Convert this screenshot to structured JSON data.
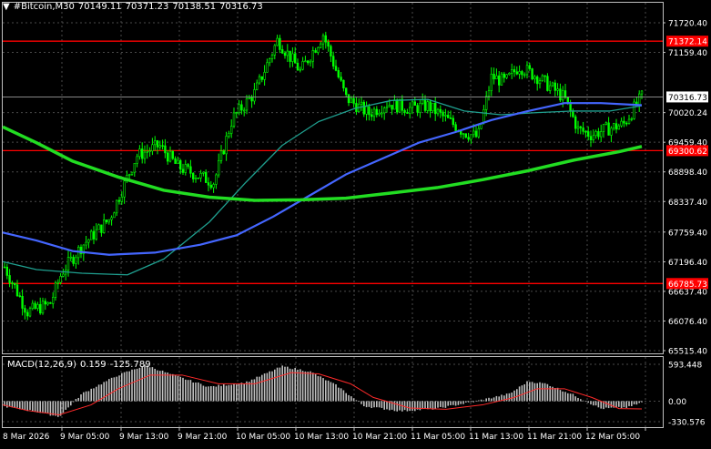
{
  "header": {
    "symbol": "#Bitcoin,M30",
    "open": "70149.11",
    "high": "70371.23",
    "low": "70138.51",
    "close": "70316.73"
  },
  "colors": {
    "background": "#000000",
    "grid": "#4a4a4a",
    "candle": "#00ff00",
    "ma_slow": "#22dd22",
    "ma_mid": "#4466ff",
    "ma_fast": "#1f9f8f",
    "level_line": "#ff0000",
    "macd_hist": "#c0c0c0",
    "macd_signal": "#ff2a2a",
    "axis_text": "#ffffff"
  },
  "price_axis": {
    "ticks": [
      "71720.40",
      "71159.40",
      "70020.24",
      "69459.40",
      "68898.40",
      "68337.40",
      "67759.40",
      "67196.40",
      "66637.40",
      "66076.40",
      "65515.40"
    ],
    "current_price": "70316.73",
    "levels": [
      {
        "value": 71372.14,
        "label": "71372.14"
      },
      {
        "value": 69300.62,
        "label": "69300.62"
      },
      {
        "value": 66785.73,
        "label": "66785.73"
      }
    ]
  },
  "macd": {
    "name": "MACD(12,26,9)",
    "main": "0.159",
    "signal": "-125.789",
    "ticks": [
      "593.448",
      "0.00",
      "-330.576"
    ]
  },
  "time_axis": {
    "labels": [
      "8 Mar 2026",
      "9 Mar 05:00",
      "9 Mar 13:00",
      "9 Mar 21:00",
      "10 Mar 05:00",
      "10 Mar 13:00",
      "10 Mar 21:00",
      "11 Mar 05:00",
      "11 Mar 13:00",
      "11 Mar 21:00",
      "12 Mar 05:00"
    ]
  }
}
